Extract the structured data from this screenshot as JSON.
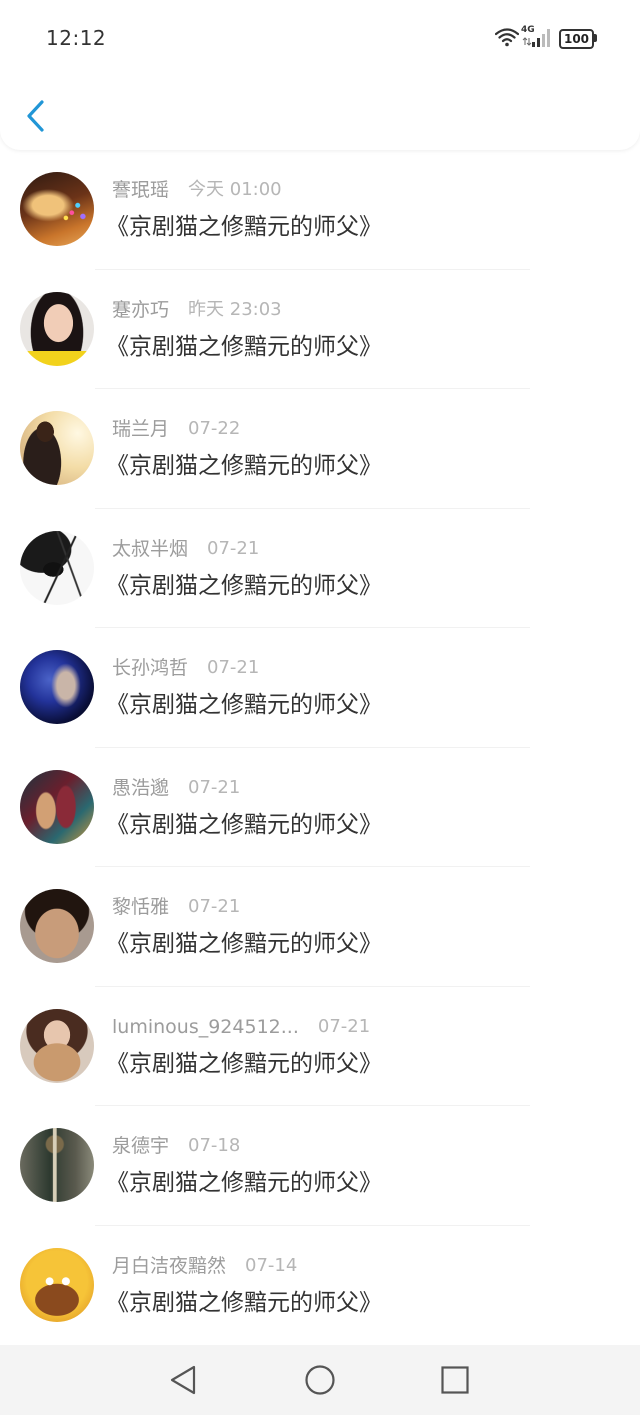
{
  "status_bar": {
    "time": "12:12",
    "network_type": "4G",
    "battery_level": "100",
    "wifi_icon": "wifi-icon",
    "signal_icon": "cell-signal-icon"
  },
  "header": {
    "back_icon": "chevron-left-icon"
  },
  "comments": [
    {
      "name": "謇珉瑶",
      "time": "今天 01:00",
      "title": "《京剧猫之修黯元的师父》"
    },
    {
      "name": "蹇亦巧",
      "time": "昨天 23:03",
      "title": "《京剧猫之修黯元的师父》"
    },
    {
      "name": "瑞兰月",
      "time": "07-22",
      "title": "《京剧猫之修黯元的师父》"
    },
    {
      "name": "太叔半烟",
      "time": "07-21",
      "title": "《京剧猫之修黯元的师父》"
    },
    {
      "name": "长孙鸿哲",
      "time": "07-21",
      "title": "《京剧猫之修黯元的师父》"
    },
    {
      "name": "愚浩邈",
      "time": "07-21",
      "title": "《京剧猫之修黯元的师父》"
    },
    {
      "name": "黎恬雅",
      "time": "07-21",
      "title": "《京剧猫之修黯元的师父》"
    },
    {
      "name": "luminous_924512...",
      "time": "07-21",
      "title": "《京剧猫之修黯元的师父》"
    },
    {
      "name": "泉德宇",
      "time": "07-18",
      "title": "《京剧猫之修黯元的师父》"
    },
    {
      "name": "月白洁夜黯然",
      "time": "07-14",
      "title": "《京剧猫之修黯元的师父》"
    }
  ],
  "nav_bar": {
    "back_icon": "triangle-back-icon",
    "home_icon": "circle-home-icon",
    "recents_icon": "square-recents-icon"
  },
  "colors": {
    "accent": "#2196d6",
    "name_text": "#9c9c9c",
    "time_text": "#b6b6b6",
    "title_text": "#333333",
    "nav_bar_bg": "#f4f4f4"
  }
}
